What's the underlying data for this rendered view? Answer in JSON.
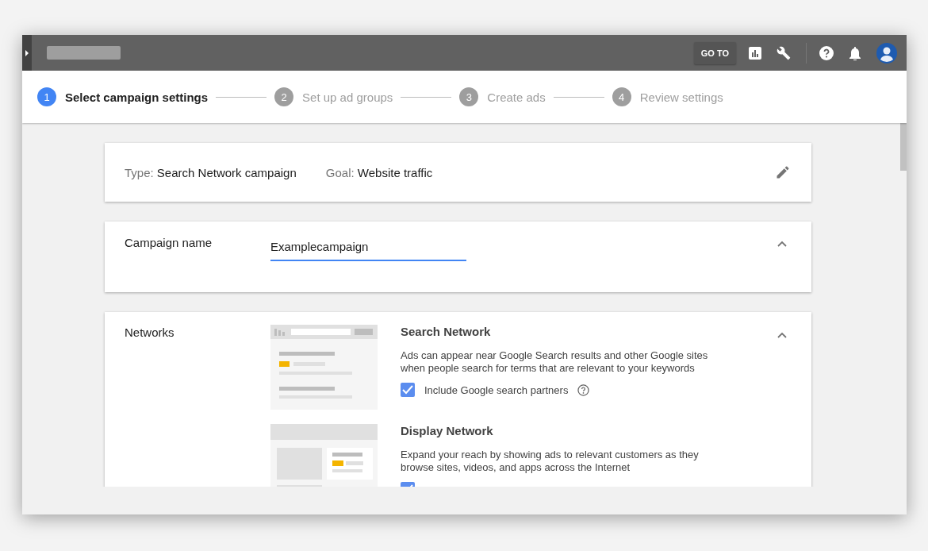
{
  "topbar": {
    "goto_label": "GO TO"
  },
  "steps": [
    {
      "number": "1",
      "label": "Select campaign settings",
      "selected": true
    },
    {
      "number": "2",
      "label": "Set up ad groups",
      "selected": false
    },
    {
      "number": "3",
      "label": "Create ads",
      "selected": false
    },
    {
      "number": "4",
      "label": "Review settings",
      "selected": false
    }
  ],
  "summary": {
    "fields": [
      {
        "label": "Type:",
        "value": "Search Network campaign"
      },
      {
        "label": "Goal:",
        "value": "Website traffic"
      }
    ]
  },
  "campaign_name": {
    "label": "Campaign name",
    "value": "Examplecampaign"
  },
  "networks": {
    "label": "Networks",
    "options": [
      {
        "kind": "search",
        "title": "Search Network",
        "description": "Ads can appear near Google Search results and other Google sites when people search for terms that are relevant to your keywords",
        "checkbox": {
          "label": "Include Google search partners",
          "checked": true
        }
      },
      {
        "kind": "display",
        "title": "Display Network",
        "description": "Expand your reach by showing ads to relevant customers as they browse sites, videos, and apps across the Internet",
        "checkbox": {
          "checked": true
        }
      }
    ]
  }
}
